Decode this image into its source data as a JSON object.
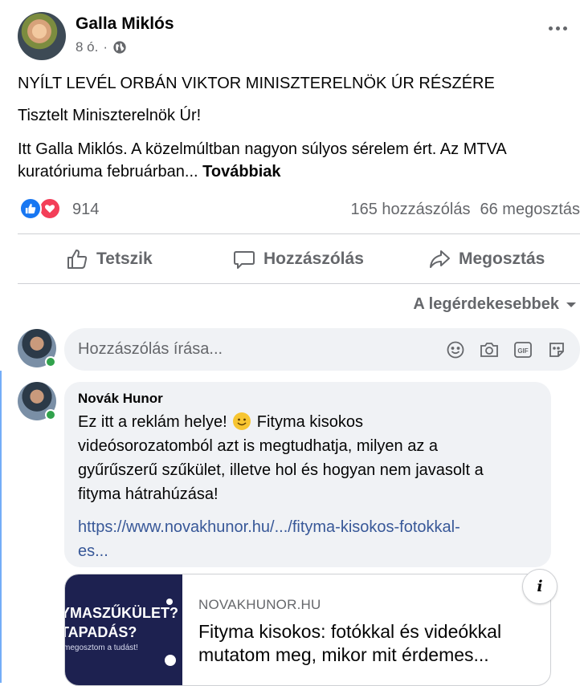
{
  "post": {
    "author": "Galla Miklós",
    "time": "8 ó.",
    "privacy_icon": "globe-icon",
    "title_line": "NYÍLT LEVÉL ORBÁN VIKTOR MINISZTERELNÖK ÚR RÉSZÉRE",
    "greeting": "Tisztelt Miniszterelnök Úr!",
    "body_line1": "Itt Galla Miklós. A közelmúltban nagyon súlyos sérelem ért. Az MTVA",
    "body_line2": "kuratóriuma februárban...",
    "see_more": "Továbbiak"
  },
  "reactions": {
    "count": "914",
    "types": [
      "like",
      "love"
    ],
    "comments": "165 hozzászólás",
    "shares": "66 megosztás"
  },
  "actions": {
    "like": "Tetszik",
    "comment": "Hozzászólás",
    "share": "Megosztás"
  },
  "sort": {
    "label": "A legérdekesebbek"
  },
  "comment_input": {
    "placeholder": "Hozzászólás írása..."
  },
  "comment": {
    "author": "Novák Hunor",
    "text_line1": "Ez itt a reklám helye!",
    "text_line1_rest": "Fityma kisokos",
    "text_line2": "videósorozatomból azt is megtudhatja, milyen az a",
    "text_line3": "gyűrűszerű szűkület, illetve hol és hogyan nem javasolt a",
    "text_line4": "fityma hátrahúzása!",
    "link_line1": "https://www.novakhunor.hu/.../fityma-kisokos-fotokkal-",
    "link_line2": "es..."
  },
  "preview": {
    "thumb_line1": "YMASZŰKÜLET?",
    "thumb_line2": "TAPADÁS?",
    "thumb_small": "megosztom a tudást!",
    "domain": "NOVAKHUNOR.HU",
    "title_line1": "Fityma kisokos: fotókkal és videókkal",
    "title_line2": "mutatom meg, mikor mit érdemes..."
  },
  "colors": {
    "accent": "#1877f2",
    "love": "#f33e58",
    "secondary_text": "#65676b",
    "link": "#385898",
    "bubble": "#f0f2f5",
    "online": "#31a24c"
  }
}
